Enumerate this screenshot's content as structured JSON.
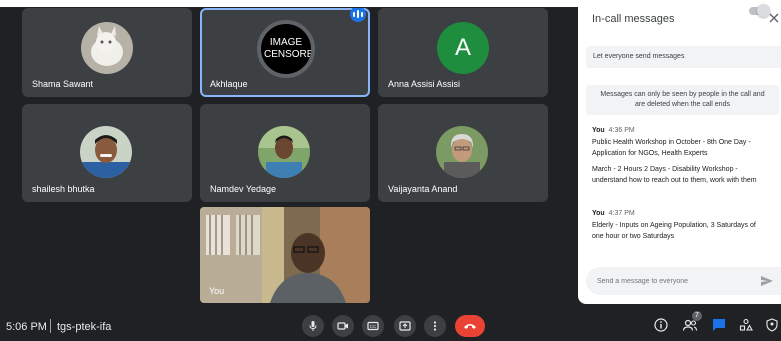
{
  "participants": [
    {
      "name": "Shama Sawant"
    },
    {
      "name": "Akhlaque",
      "avatar_text": "IMAGE CENSORED"
    },
    {
      "name": "Anna Assisi Assisi",
      "initial": "A"
    },
    {
      "name": "shailesh bhutka"
    },
    {
      "name": "Namdev Yedage"
    },
    {
      "name": "Vaijayanta Anand"
    },
    {
      "name": "You"
    }
  ],
  "bottom_bar": {
    "time": "5:06 PM",
    "separator": "|",
    "meeting_code": "tgs-ptek-ifa",
    "people_count": "7"
  },
  "chat": {
    "title": "In-call messages",
    "toggle_label": "Let everyone send messages",
    "notice_line1": "Messages can only be seen by people in the call and",
    "notice_line2": "are deleted when the call ends",
    "messages": [
      {
        "sender": "You",
        "time": "4:36 PM",
        "lines": [
          "Public Health Workshop in October - 8th One Day -",
          "Application for NGOs, Health Experts",
          "March - 2 Hours 2 Days - Disability Workshop -",
          "understand how to reach out to them, work with them"
        ]
      },
      {
        "sender": "You",
        "time": "4:37 PM",
        "lines": [
          "Elderly - Inputs on Ageing Population, 3 Saturdays of",
          "one hour or two Saturdays"
        ]
      }
    ],
    "input_placeholder": "Send a message to everyone"
  },
  "colors": {
    "background": "#202124",
    "tile": "#3c4043",
    "active_outline": "#8ab4f8",
    "end_call": "#ea4335",
    "chat_icon": "#1a73e8"
  },
  "icons": [
    "mic-icon",
    "camera-icon",
    "captions-icon",
    "present-icon",
    "more-icon",
    "end-call-icon",
    "info-icon",
    "people-icon",
    "chat-icon",
    "activities-icon",
    "host-controls-icon",
    "close-icon",
    "send-icon"
  ]
}
